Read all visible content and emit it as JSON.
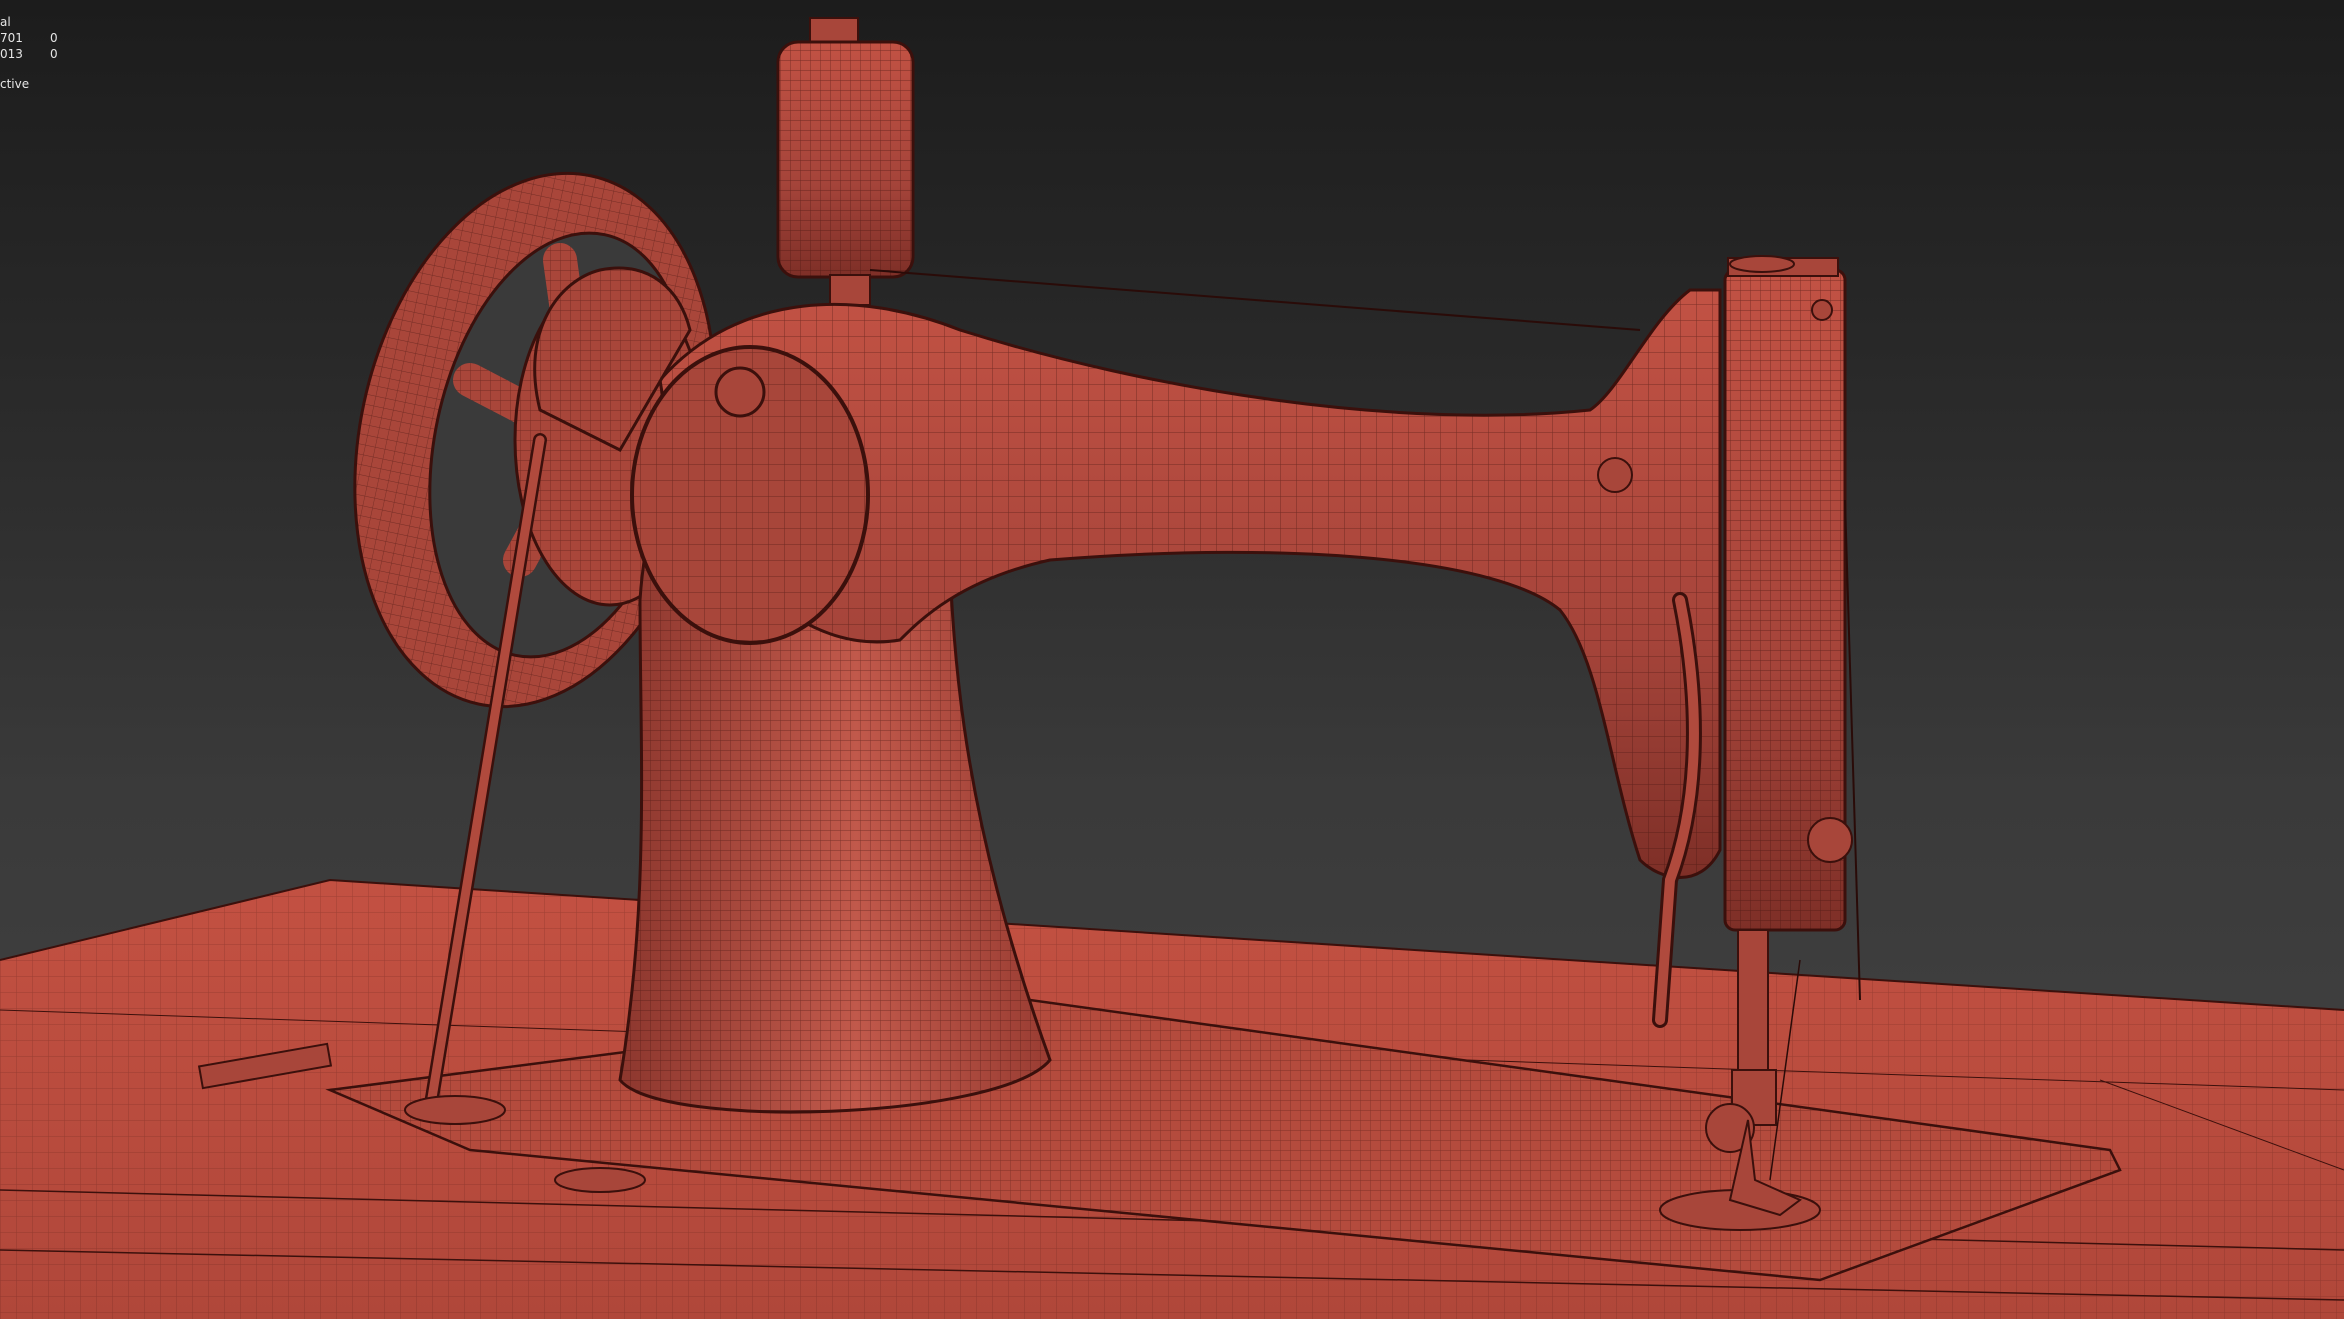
{
  "viewport": {
    "stats": {
      "header": "al",
      "rows": [
        {
          "label": "701",
          "value": "0"
        },
        {
          "label": "013",
          "value": "0"
        }
      ],
      "view_mode": "ctive"
    }
  },
  "colors": {
    "model_fill": "#a8463a",
    "wire": "#3b100c",
    "background_top": "#1c1c1c",
    "background_bottom": "#444444"
  },
  "model": {
    "name": "sewing-machine",
    "display": "wireframe-on-shaded"
  }
}
